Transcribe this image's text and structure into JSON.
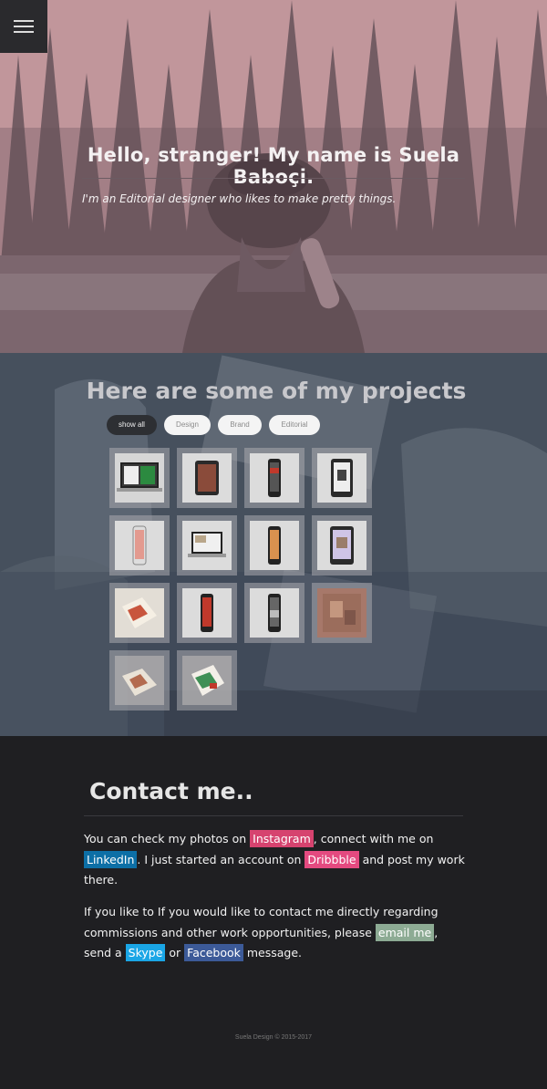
{
  "hero": {
    "title": "Hello, stranger! My name is Suela Baboçi.",
    "subtitle": "I'm an Editorial designer who likes to make pretty things."
  },
  "menu": {
    "icon": "hamburger-icon"
  },
  "projects": {
    "title": "Here are some of my projects",
    "filters": [
      "show all",
      "Design",
      "Brand",
      "Editorial"
    ],
    "active_filter": "show all",
    "thumbnails": [
      "magazine-laptop-mockup",
      "tablet-mockup",
      "phone-mockup",
      "tablet-mockup",
      "phone-mockup",
      "laptop-mockup",
      "phone-mockup",
      "tablet-mockup",
      "brochure-mockup",
      "phone-mockup",
      "phone-mockup",
      "print-mockup",
      "brochure-mockup",
      "brochure-mockup"
    ]
  },
  "contact": {
    "title": "Contact me..",
    "p1": {
      "t1": "You can check my photos on ",
      "instagram": "Instagram",
      "t2": ", connect with me on ",
      "linkedin": "LinkedIn",
      "t3": ". I just started an account on ",
      "dribbble": "Dribbble",
      "t4": " and post my work there."
    },
    "p2": {
      "t1": "If you like to If you would like to contact me directly regarding commissions and other work opportunities, please ",
      "email": "email me",
      "t2": ", send a ",
      "skype": "Skype",
      "t3": " or ",
      "facebook": "Facebook",
      "t4": " message."
    },
    "colors": {
      "instagram": "#d6436f",
      "linkedin": "#0d6fa6",
      "dribbble": "#e44a80",
      "email": "#8dab94",
      "skype": "#1aa6e6",
      "facebook": "#3c5a98"
    }
  },
  "footer": {
    "text": "Suela Design © 2015-2017"
  }
}
